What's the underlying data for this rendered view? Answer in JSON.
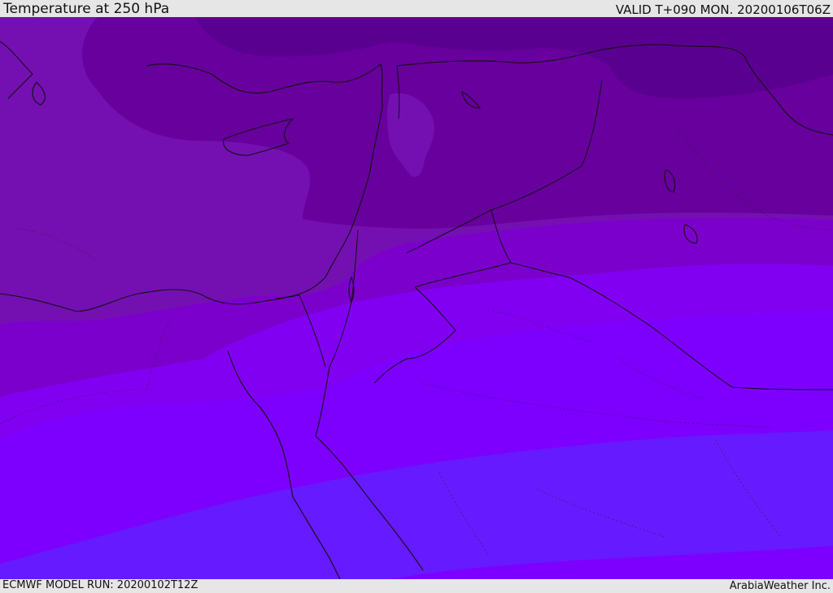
{
  "header": {
    "title": "Temperature at 250 hPa",
    "valid": "VALID T+090 MON. 20200106T06Z"
  },
  "footer": {
    "model_run": "ECMWF MODEL RUN: 20200102T12Z",
    "brand": "ArabiaWeather Inc."
  },
  "map": {
    "field": "temperature",
    "level": "250 hPa",
    "region": "Eastern Mediterranean / Middle East",
    "colors": {
      "coldest": "#5a0090",
      "very_cold": "#67009d",
      "cold": "#7410b2",
      "mid": "#7b00cc",
      "warm": "#8200f2",
      "warmer": "#7d00ff",
      "warmest": "#661aff",
      "coastline": "#111111",
      "border": "#111111"
    }
  }
}
